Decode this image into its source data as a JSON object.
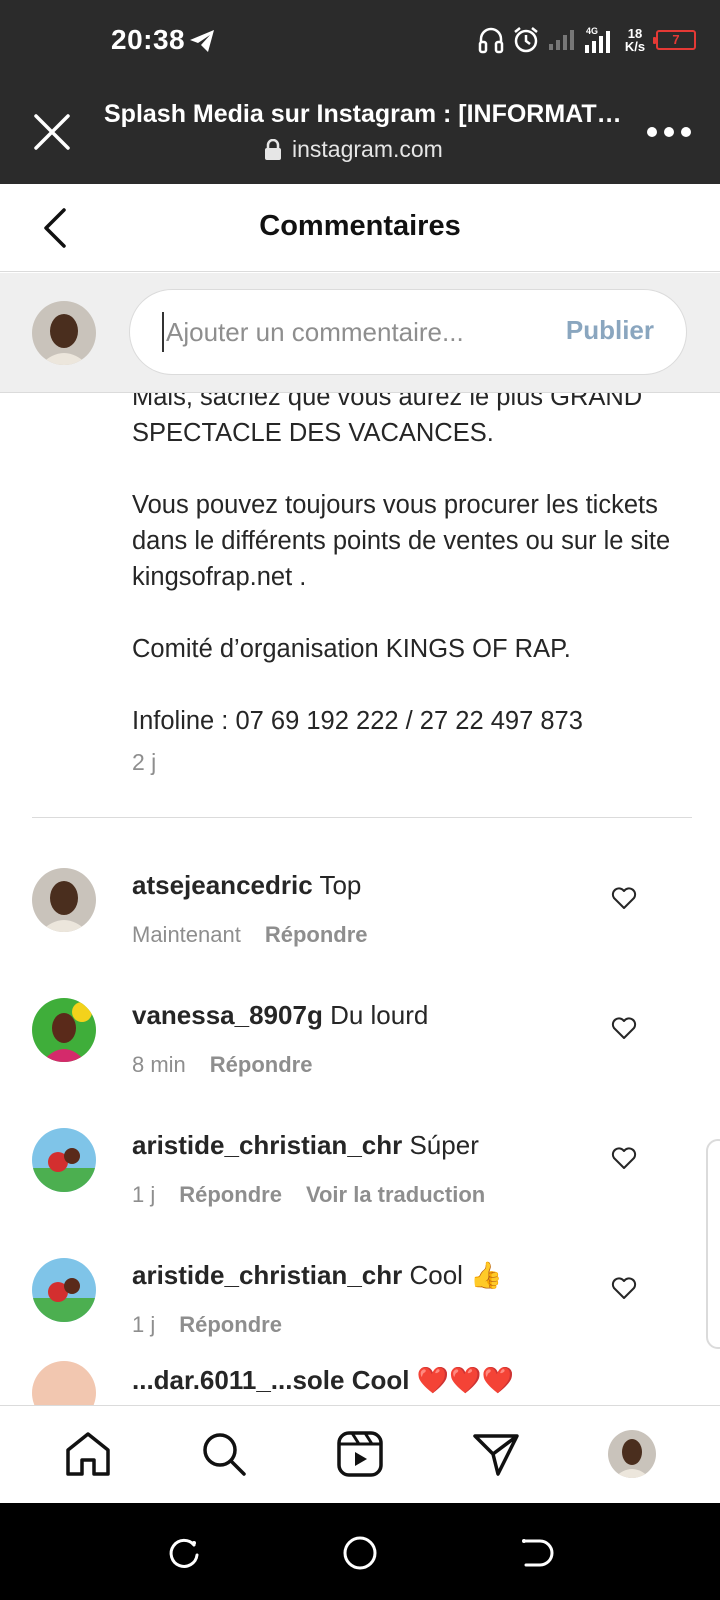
{
  "status_bar": {
    "time": "20:38",
    "telegram_icon": "telegram-plane-icon",
    "net_speed_top": "18",
    "net_speed_bottom": "K/s",
    "network_label": "4G",
    "battery_level": "7",
    "battery_color": "#e53935"
  },
  "browser": {
    "title": "Splash Media sur Instagram : [INFORMATI…",
    "url": "instagram.com"
  },
  "header": {
    "title": "Commentaires"
  },
  "composer": {
    "placeholder": "Ajouter un commentaire...",
    "value": "",
    "publish_label": "Publier",
    "publish_color": "#8aa6bf"
  },
  "caption": {
    "paragraphs": [
      "Mais, sachez que vous aurez le plus GRAND SPECTACLE DES VACANCES.",
      "Vous pouvez toujours vous procurer les tickets dans le différents points de ventes ou sur le site kingsofrap.net .",
      "Comité d’organisation KINGS OF RAP.",
      "Infoline : 07 69 192 222 / 27 22 497 873"
    ],
    "time": "2 j"
  },
  "comments": [
    {
      "username": "atsejeancedric",
      "text": "Top",
      "time": "Maintenant",
      "reply_label": "Répondre"
    },
    {
      "username": "vanessa_8907g",
      "text": "Du lourd",
      "time": "8 min",
      "reply_label": "Répondre"
    },
    {
      "username": "aristide_christian_chr",
      "text": "Súper",
      "time": "1 j",
      "reply_label": "Répondre",
      "translate_label": "Voir la traduction"
    },
    {
      "username": "aristide_christian_chr",
      "text": "Cool 👍",
      "time": "1 j",
      "reply_label": "Répondre"
    }
  ],
  "partial_comment": {
    "text": "...dar.6011_...sole Cool ❤️❤️❤️"
  },
  "bottom_nav": {
    "items": [
      "home-icon",
      "search-icon",
      "reels-icon",
      "direct-icon",
      "profile-avatar"
    ]
  },
  "system_nav": {
    "items": [
      "recents-icon",
      "home-circle-icon",
      "back-icon"
    ]
  },
  "colors": {
    "dark_bar": "#2b2b2b",
    "divider": "#dbdbdb",
    "secondary_text": "#8e8e8e",
    "like_heart": "#262626"
  }
}
